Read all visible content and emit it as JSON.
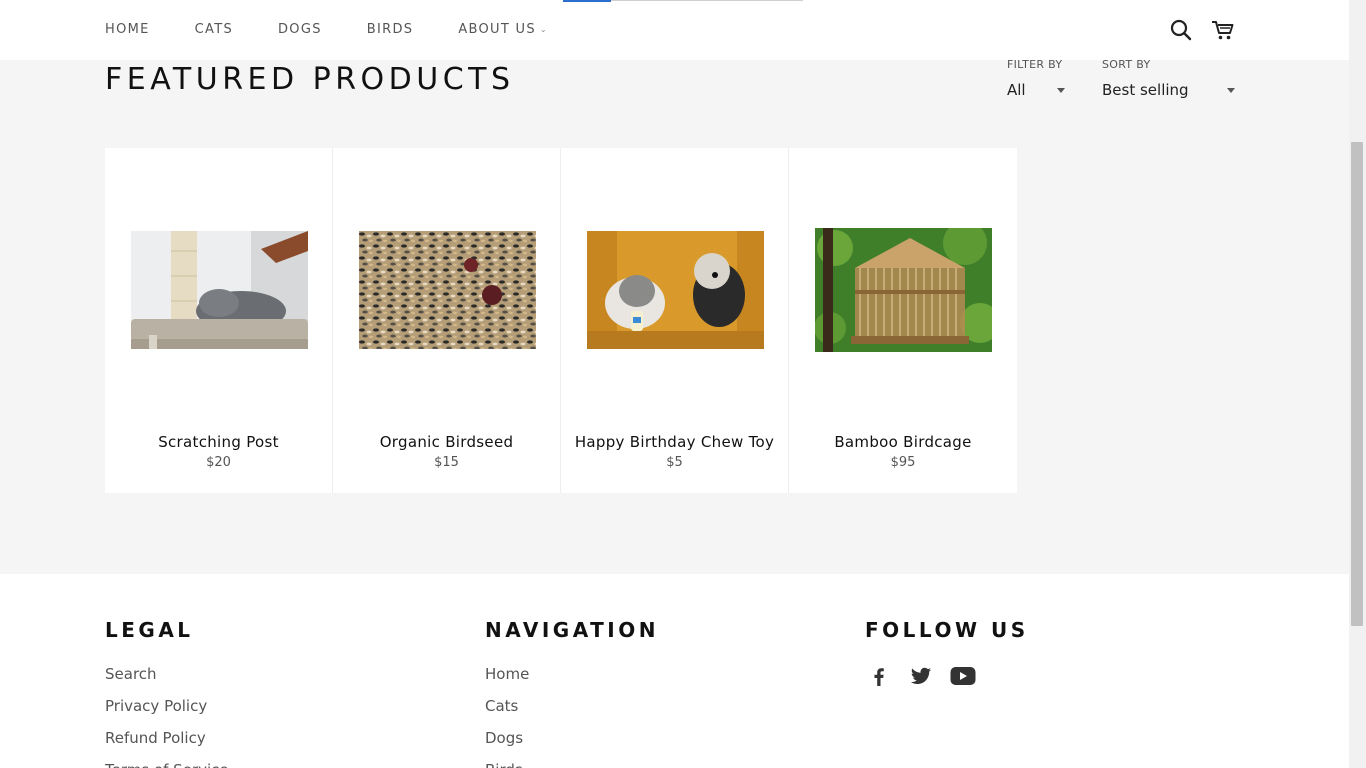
{
  "nav": {
    "items": [
      "HOME",
      "CATS",
      "DOGS",
      "BIRDS",
      "ABOUT US"
    ],
    "about_chevron": "⌄"
  },
  "header_icons": [
    "search-icon",
    "cart-icon"
  ],
  "collection": {
    "title": "FEATURED PRODUCTS",
    "filter_label": "FILTER BY",
    "filter_value": "All",
    "sort_label": "SORT BY",
    "sort_value": "Best selling"
  },
  "products": [
    {
      "name": "Scratching Post",
      "price": "$20"
    },
    {
      "name": "Organic Birdseed",
      "price": "$15"
    },
    {
      "name": "Happy Birthday Chew Toy",
      "price": "$5"
    },
    {
      "name": "Bamboo Birdcage",
      "price": "$95"
    }
  ],
  "footer": {
    "legal": {
      "heading": "LEGAL",
      "links": [
        "Search",
        "Privacy Policy",
        "Refund Policy",
        "Terms of Service"
      ]
    },
    "navigation": {
      "heading": "NAVIGATION",
      "links": [
        "Home",
        "Cats",
        "Dogs",
        "Birds"
      ]
    },
    "follow": {
      "heading": "FOLLOW US",
      "icons": [
        "facebook-icon",
        "twitter-icon",
        "youtube-icon"
      ]
    }
  },
  "colors": {
    "accent": "#2c6ecb",
    "background": "#f5f5f5"
  }
}
